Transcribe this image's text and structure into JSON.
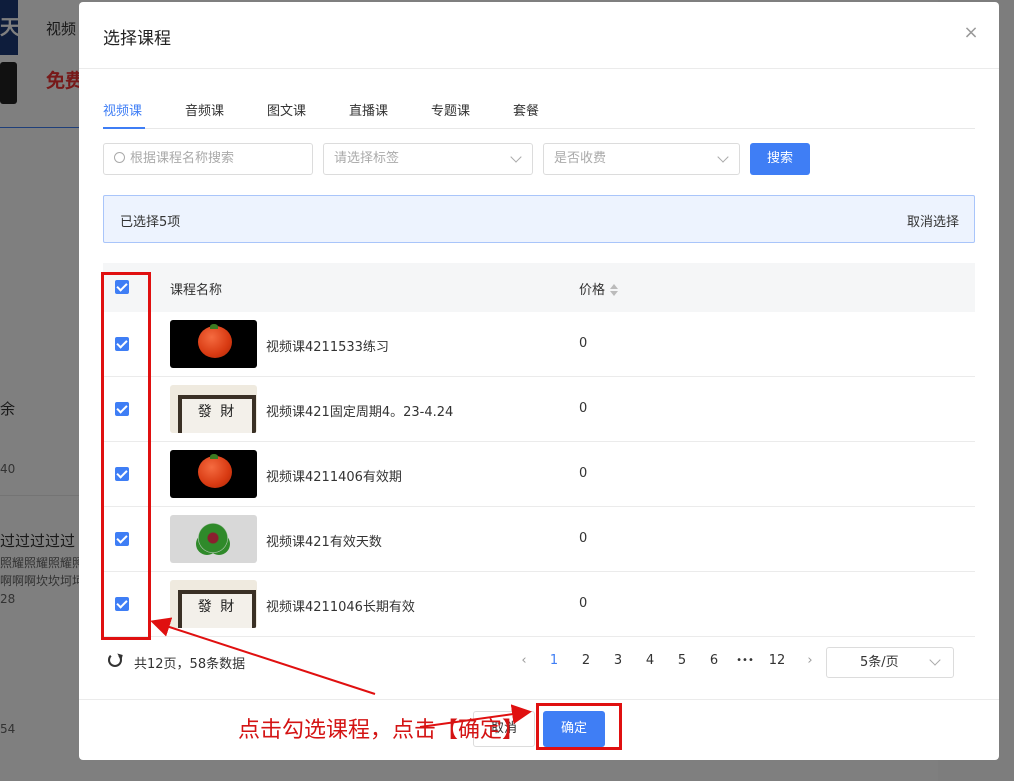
{
  "background": {
    "thumb_char": "天",
    "title_fragment": "视频",
    "price_fragment": "免费",
    "left_texts": [
      "余",
      "40",
      "过过过过过",
      "照耀照耀照耀照",
      "啊啊啊坎坎坷坷",
      "28",
      "54"
    ]
  },
  "dialog": {
    "title": "选择课程",
    "close_glyph": "×",
    "tabs": [
      "视频课",
      "音频课",
      "图文课",
      "直播课",
      "专题课",
      "套餐"
    ],
    "active_tab": 0,
    "filters": {
      "search_placeholder": "根据课程名称搜索",
      "tag_placeholder": "请选择标签",
      "fee_placeholder": "是否收费",
      "search_button": "搜索"
    },
    "selection": {
      "count_text": "已选择5项",
      "clear_text": "取消选择"
    },
    "table": {
      "columns": [
        "课程名称",
        "价格"
      ],
      "rows": [
        {
          "name": "视频课4211533练习",
          "price": "0",
          "cover": "tomato"
        },
        {
          "name": "视频课421固定周期4。23-4.24",
          "price": "0",
          "cover": "frame"
        },
        {
          "name": "视频课4211406有效期",
          "price": "0",
          "cover": "tomato"
        },
        {
          "name": "视频课421有效天数",
          "price": "0",
          "cover": "clover"
        },
        {
          "name": "视频课4211046长期有效",
          "price": "0",
          "cover": "frame"
        }
      ]
    },
    "pagination": {
      "summary": "共12页，58条数据",
      "pages": [
        "1",
        "2",
        "3",
        "4",
        "5",
        "6",
        "•••",
        "12"
      ],
      "current_page": "1",
      "prev": "‹",
      "next": "›",
      "page_size": "5条/页"
    },
    "footer": {
      "cancel_label": "取消",
      "confirm_label": "确定"
    }
  },
  "annotation": {
    "text": "点击勾选课程，点击【确定】",
    "color": "#e01010"
  },
  "colors": {
    "primary": "#3f7ef5",
    "annotation_red": "#e01010"
  }
}
